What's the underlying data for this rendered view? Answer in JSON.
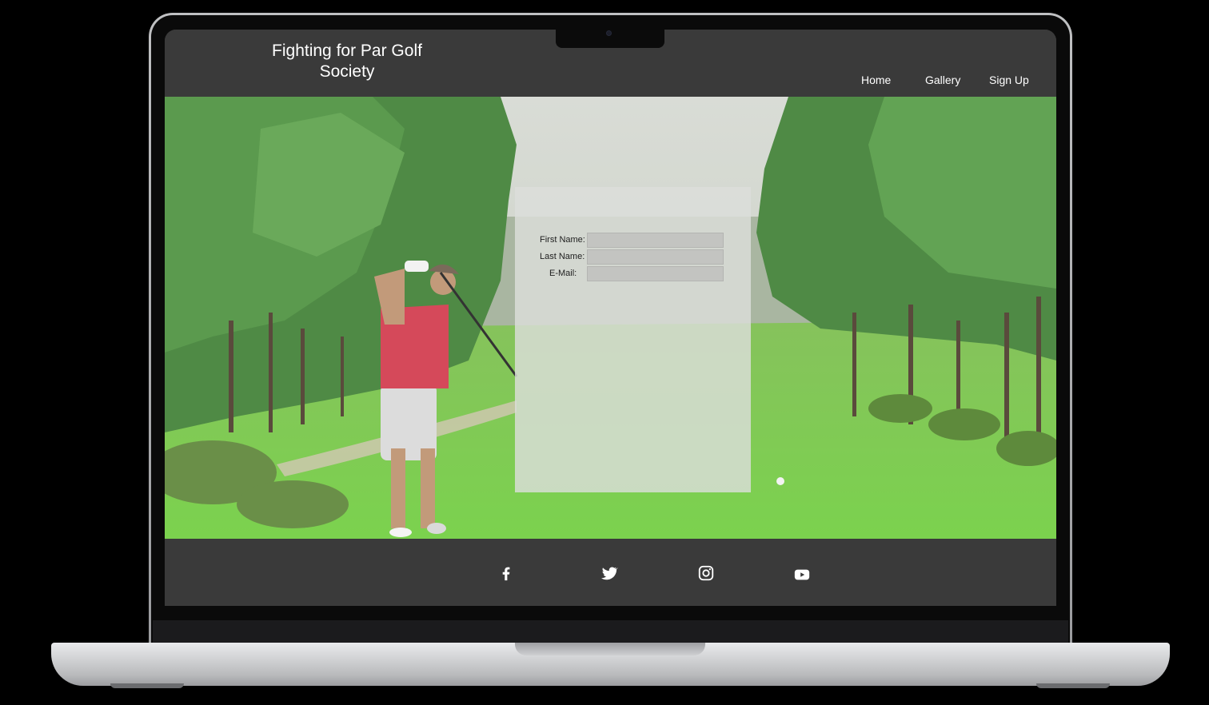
{
  "header": {
    "title_line1": "Fighting for Par Golf",
    "title_line2": "Society"
  },
  "nav": {
    "items": [
      {
        "label": "Home"
      },
      {
        "label": "Gallery"
      },
      {
        "label": "Sign Up"
      }
    ]
  },
  "form": {
    "first_name_label": "First Name:",
    "first_name_value": "",
    "last_name_label": "Last Name:",
    "last_name_value": "",
    "email_label": "E-Mail:",
    "email_value": ""
  },
  "footer": {
    "social_icons": [
      "facebook-icon",
      "twitter-icon",
      "instagram-icon",
      "youtube-icon"
    ]
  },
  "colors": {
    "header_bg": "#3a3a3a",
    "footer_bg": "#3a3a3a",
    "text": "#ffffff",
    "form_panel": "#dcded9"
  }
}
